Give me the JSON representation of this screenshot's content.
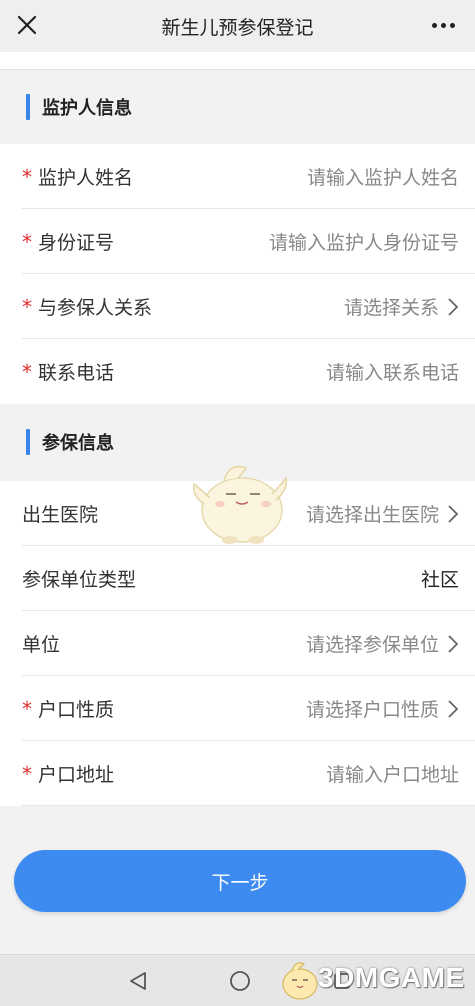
{
  "header": {
    "title": "新生儿预参保登记",
    "close_icon": "close-icon",
    "more_icon": "more-icon"
  },
  "guardian": {
    "title": "监护人信息",
    "rows": [
      {
        "required": "*",
        "label": "监护人姓名",
        "placeholder": "请输入监护人姓名",
        "chevron": false
      },
      {
        "required": "*",
        "label": "身份证号",
        "placeholder": "请输入监护人身份证号",
        "chevron": false
      },
      {
        "required": "*",
        "label": "与参保人关系",
        "placeholder": "请选择关系",
        "chevron": true
      },
      {
        "required": "*",
        "label": "联系电话",
        "placeholder": "请输入联系电话",
        "chevron": false
      }
    ]
  },
  "insurance": {
    "title": "参保信息",
    "rows": [
      {
        "required": "",
        "label": "出生医院",
        "placeholder": "请选择出生医院",
        "chevron": true
      },
      {
        "required": "",
        "label": "参保单位类型",
        "value": "社区",
        "chevron": false
      },
      {
        "required": "",
        "label": "单位",
        "placeholder": "请选择参保单位",
        "chevron": true
      },
      {
        "required": "*",
        "label": "户口性质",
        "placeholder": "请选择户口性质",
        "chevron": true
      },
      {
        "required": "*",
        "label": "户口地址",
        "placeholder": "请输入户口地址",
        "chevron": false
      }
    ]
  },
  "next_button": {
    "label": "下一步"
  },
  "navbar": {
    "back_icon": "back-triangle-icon",
    "home_icon": "home-circle-icon",
    "recents_icon": "recents-square-icon"
  },
  "watermark": {
    "text": "3DMGAME"
  },
  "colors": {
    "accent": "#3d8bf0",
    "section_bar": "#3a86e8",
    "required": "#e03030"
  }
}
